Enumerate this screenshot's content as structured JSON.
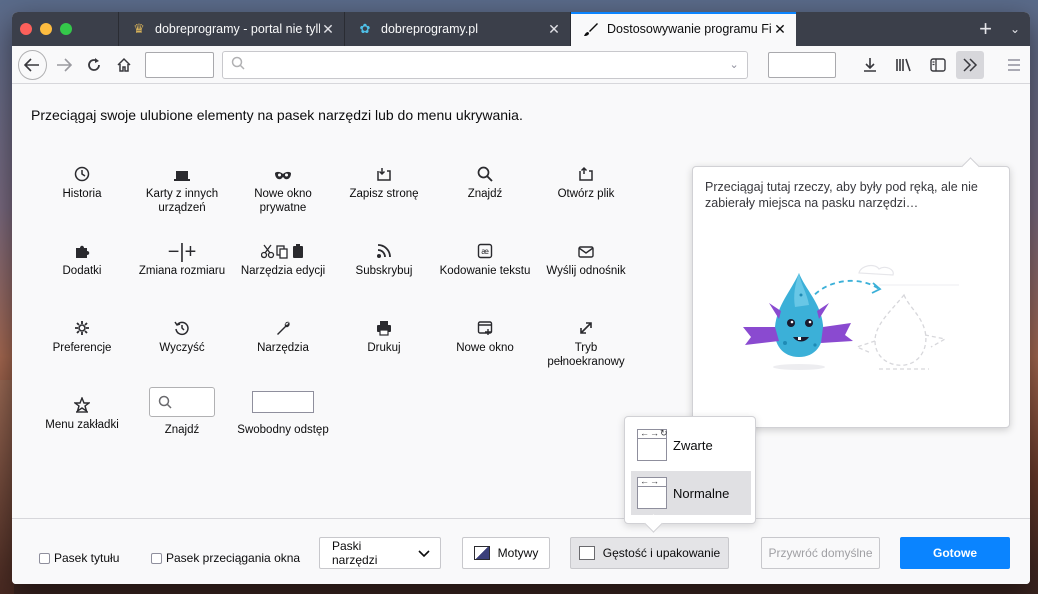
{
  "tabs": [
    {
      "title": "dobreprogramy - portal nie tylko",
      "favicon": "dobreprogramy-favicon",
      "active": false
    },
    {
      "title": "dobreprogramy.pl",
      "favicon": "dobreprogramy-pl-favicon",
      "active": false
    },
    {
      "title": "Dostosowywanie programu Fire",
      "favicon": "brush-icon",
      "active": true
    }
  ],
  "nav": {
    "url_value": "",
    "url_placeholder": ""
  },
  "customize": {
    "instruction": "Przeciągaj swoje ulubione elementy na pasek narzędzi lub do menu ukrywania.",
    "items": [
      {
        "label": "Historia",
        "icon": "clock-icon",
        "glyph": "◷"
      },
      {
        "label": "Karty z innych urządzeń",
        "icon": "synced-tabs-icon",
        "glyph": "▬"
      },
      {
        "label": "Nowe okno prywatne",
        "icon": "private-mask-icon",
        "glyph": "∞"
      },
      {
        "label": "Zapisz stronę",
        "icon": "save-page-icon",
        "glyph": "⎘"
      },
      {
        "label": "Znajdź",
        "icon": "magnifier-icon",
        "glyph": "⚲"
      },
      {
        "label": "Otwórz plik",
        "icon": "open-file-icon",
        "glyph": "⎗"
      },
      {
        "label": "Dodatki",
        "icon": "puzzle-icon",
        "glyph": "✚"
      },
      {
        "label": "Zmiana rozmiaru",
        "icon": "zoom-controls-icon",
        "glyph": "−|+"
      },
      {
        "label": "Narzędzia edycji",
        "icon": "edit-controls-icon",
        "glyph": "✂⎘▤"
      },
      {
        "label": "Subskrybuj",
        "icon": "rss-icon",
        "glyph": "◝"
      },
      {
        "label": "Kodowanie tekstu",
        "icon": "text-encoding-icon",
        "glyph": "Ⓐ"
      },
      {
        "label": "Wyślij odnośnik",
        "icon": "email-link-icon",
        "glyph": "✉"
      },
      {
        "label": "Preferencje",
        "icon": "gear-icon",
        "glyph": "✲"
      },
      {
        "label": "Wyczyść",
        "icon": "forget-history-icon",
        "glyph": "↺"
      },
      {
        "label": "Narzędzia",
        "icon": "wrench-icon",
        "glyph": "🔧"
      },
      {
        "label": "Drukuj",
        "icon": "printer-icon",
        "glyph": "⎙"
      },
      {
        "label": "Nowe okno",
        "icon": "new-window-icon",
        "glyph": "⊞"
      },
      {
        "label": "Tryb pełnoekranowy",
        "icon": "fullscreen-icon",
        "glyph": "⤢"
      },
      {
        "label": "Menu zakładki",
        "icon": "bookmark-star-icon",
        "glyph": "☆"
      },
      {
        "label": "Znajdź",
        "icon": "search-box-icon",
        "glyph": "⚲"
      },
      {
        "label": "Swobodny odstęp",
        "icon": "flexible-space-icon",
        "glyph": ""
      }
    ]
  },
  "overflow_panel": {
    "text": "Przeciągaj tutaj rzeczy, aby były pod ręką, ale nie zabierały miejsca na pasku narzędzi…"
  },
  "footer": {
    "titlebar_checkbox": "Pasek tytułu",
    "dragspace_checkbox": "Pasek przeciągania okna",
    "toolbars_label": "Paski narzędzi",
    "themes_label": "Motywy",
    "density_label": "Gęstość i upakowanie",
    "restore_label": "Przywróć domyślne",
    "done_label": "Gotowe"
  },
  "density_popup": {
    "options": [
      {
        "label": "Zwarte",
        "selected": false
      },
      {
        "label": "Normalne",
        "selected": true
      }
    ]
  },
  "colors": {
    "accent": "#0a84ff",
    "tabstrip": "#3b3f4a",
    "dragon": "#3bb0d8",
    "wings": "#8a4ad0"
  }
}
